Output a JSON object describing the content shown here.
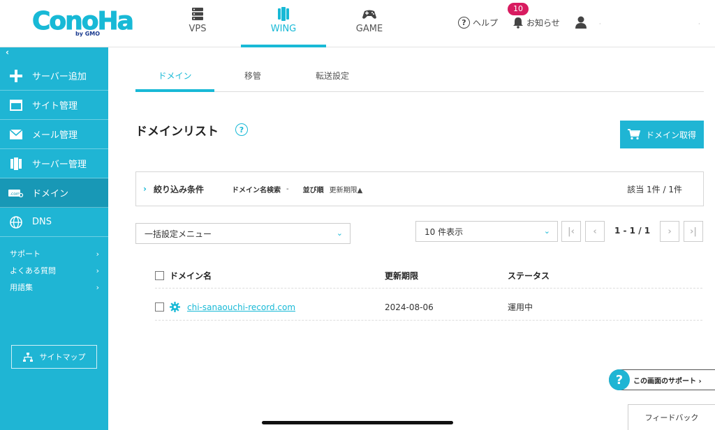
{
  "header": {
    "logo_text": "ConoHa",
    "logo_sub": "by GMO",
    "nav": [
      {
        "label": "VPS",
        "icon": "server-icon"
      },
      {
        "label": "WING",
        "icon": "wing-server-icon"
      },
      {
        "label": "GAME",
        "icon": "gamepad-icon"
      }
    ],
    "help_label": "ヘルプ",
    "notice_label": "お知らせ",
    "notice_count": "10",
    "user_dots": "·",
    "far_dot": "·"
  },
  "sidebar": {
    "collapse": "‹",
    "items": [
      {
        "label": "サーバー追加",
        "icon": "plus-icon"
      },
      {
        "label": "サイト管理",
        "icon": "window-icon"
      },
      {
        "label": "メール管理",
        "icon": "mail-icon"
      },
      {
        "label": "サーバー管理",
        "icon": "server-stack-icon"
      },
      {
        "label": "ドメイン",
        "icon": "domain-icon"
      },
      {
        "label": "DNS",
        "icon": "globe-icon"
      }
    ],
    "sublinks": [
      {
        "label": "サポート",
        "arrow": "›"
      },
      {
        "label": "よくある質問",
        "arrow": "›"
      },
      {
        "label": "用語集",
        "arrow": "›"
      }
    ],
    "sitemap_label": "サイトマップ"
  },
  "tabs": [
    {
      "label": "ドメイン"
    },
    {
      "label": "移管"
    },
    {
      "label": "転送設定"
    }
  ],
  "main": {
    "title": "ドメインリスト",
    "help_icon": "?",
    "get_domain_label": "ドメイン取得"
  },
  "filter": {
    "chevron": "›",
    "title": "絞り込み条件",
    "search_key": "ドメイン名検索",
    "search_value": "-",
    "sort_key": "並び順",
    "sort_value": "更新期限▲",
    "count": "該当 1件 / 1件"
  },
  "controls": {
    "bulk_menu": "一括設定メニュー",
    "per_page": "10 件表示",
    "caret": "⌄",
    "first": "|‹",
    "prev": "‹",
    "page_info": "1 - 1 / 1",
    "next": "›",
    "last": "›|"
  },
  "table": {
    "columns": [
      "ドメイン名",
      "更新期限",
      "ステータス"
    ],
    "rows": [
      {
        "domain": "chi-sanaouchi-record.com",
        "expiry": "2024-08-06",
        "status": "運用中"
      }
    ]
  },
  "support_label": "この画面のサポート ›",
  "support_q": "?",
  "feedback_label": "フィードバック",
  "colors": {
    "accent": "#1fb5d4",
    "sidebar_active": "#1898b6",
    "badge": "#d81b60"
  }
}
